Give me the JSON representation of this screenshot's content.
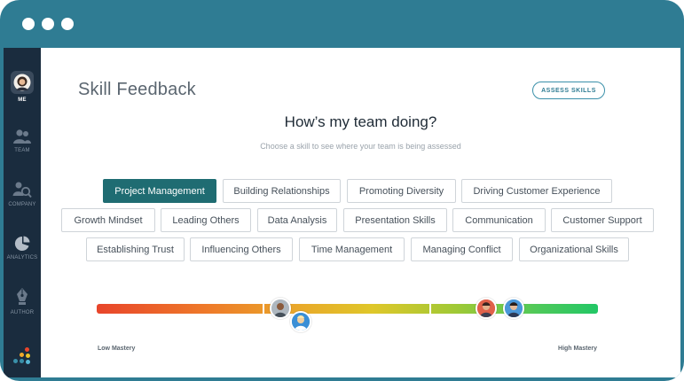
{
  "window": {
    "titlebar_color": "#2f7c93"
  },
  "sidebar": {
    "items": [
      {
        "label": "ME",
        "icon": "user-avatar-icon",
        "active": true
      },
      {
        "label": "TEAM",
        "icon": "team-icon",
        "active": false
      },
      {
        "label": "COMPANY",
        "icon": "company-search-icon",
        "active": false
      },
      {
        "label": "ANALYTICS",
        "icon": "pie-chart-icon",
        "active": false
      },
      {
        "label": "AUTHOR",
        "icon": "pen-nib-icon",
        "active": false
      }
    ],
    "brand_icon": "brand-dots-icon"
  },
  "header": {
    "title": "Skill Feedback",
    "assess_button": "ASSESS SKILLS"
  },
  "prompt": {
    "question": "How’s my team doing?",
    "hint": "Choose a skill to see where your team is being assessed"
  },
  "skills": {
    "selected": "Project Management",
    "rows": [
      [
        "Project Management",
        "Building Relationships",
        "Promoting Diversity",
        "Driving Customer Experience"
      ],
      [
        "Growth Mindset",
        "Leading Others",
        "Data Analysis",
        "Presentation Skills",
        "Communication",
        "Customer Support"
      ],
      [
        "Establishing Trust",
        "Influencing Others",
        "Time Management",
        "Managing Conflict",
        "Organizational Skills"
      ]
    ]
  },
  "mastery_scale": {
    "low_label": "Low Mastery",
    "high_label": "High Mastery",
    "team_positions": [
      0.37,
      0.41,
      0.78,
      0.835
    ]
  },
  "colors": {
    "accent": "#2f7c93",
    "selected_chip": "#1f6c72",
    "low": "#e8452b",
    "high": "#22c766"
  }
}
